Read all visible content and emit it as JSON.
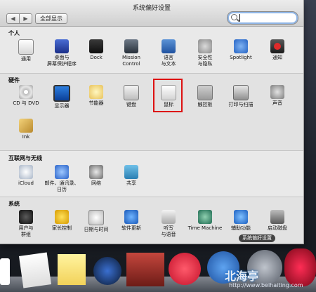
{
  "window": {
    "title": "系统偏好设置",
    "nav_back": "◀",
    "nav_forward": "▶",
    "show_all": "全部显示",
    "search_value": ""
  },
  "sections": {
    "personal": "个人",
    "hardware": "硬件",
    "internet": "互联网与无线",
    "system": "系统"
  },
  "personal_items": [
    {
      "label": "通用",
      "icon": "general-icon"
    },
    {
      "label": "桌面与\n屏幕保护程序",
      "icon": "desktop-icon"
    },
    {
      "label": "Dock",
      "icon": "dock-icon"
    },
    {
      "label": "Mission\nControl",
      "icon": "mission-control-icon"
    },
    {
      "label": "语言\n与文本",
      "icon": "language-icon"
    },
    {
      "label": "安全性\n与隐私",
      "icon": "security-icon"
    },
    {
      "label": "Spotlight",
      "icon": "spotlight-icon"
    },
    {
      "label": "通知",
      "icon": "notifications-icon"
    }
  ],
  "hardware_items": [
    {
      "label": "CD 与 DVD",
      "icon": "cd-icon"
    },
    {
      "label": "显示器",
      "icon": "display-icon"
    },
    {
      "label": "节能器",
      "icon": "energy-icon"
    },
    {
      "label": "键盘",
      "icon": "keyboard-icon"
    },
    {
      "label": "鼠标",
      "icon": "mouse-icon"
    },
    {
      "label": "触控板",
      "icon": "trackpad-icon"
    },
    {
      "label": "打印与扫描",
      "icon": "print-icon"
    },
    {
      "label": "声音",
      "icon": "sound-icon"
    },
    {
      "label": "Ink",
      "icon": "ink-icon"
    }
  ],
  "internet_items": [
    {
      "label": "iCloud",
      "icon": "icloud-icon"
    },
    {
      "label": "邮件、通讯录、\n日历",
      "icon": "mail-icon"
    },
    {
      "label": "网络",
      "icon": "network-icon"
    },
    {
      "label": "共享",
      "icon": "sharing-icon"
    }
  ],
  "system_items": [
    {
      "label": "用户与\n群组",
      "icon": "users-icon"
    },
    {
      "label": "家长控制",
      "icon": "parental-icon"
    },
    {
      "label": "日期与时间",
      "icon": "date-icon"
    },
    {
      "label": "软件更新",
      "icon": "update-icon"
    },
    {
      "label": "听写\n与语音",
      "icon": "speech-icon"
    },
    {
      "label": "Time Machine",
      "icon": "time-machine-icon"
    },
    {
      "label": "辅助功能",
      "icon": "accessibility-icon"
    },
    {
      "label": "启动磁盘",
      "icon": "startup-disk-icon"
    }
  ],
  "dock_tooltip": "系统偏好设置",
  "watermark": {
    "text": "北海亭",
    "url": "http://www.beihaiting.com"
  }
}
